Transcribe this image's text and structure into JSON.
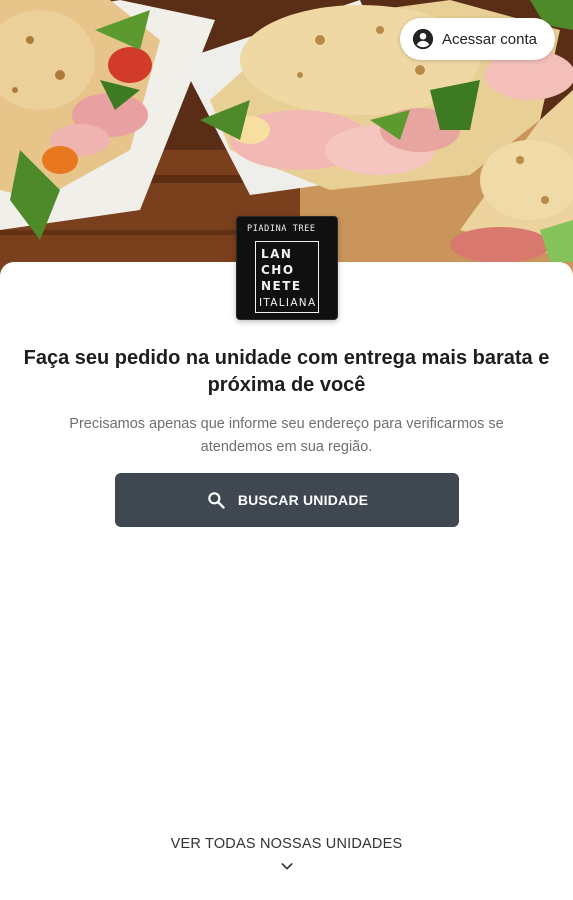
{
  "header": {
    "account_label": "Acessar conta",
    "account_icon": "account-circle-icon"
  },
  "logo": {
    "brand": "PIADINA TREE",
    "line1": "LAN",
    "line2": "CHO",
    "line3": "NETE",
    "line4": "ITALIANA"
  },
  "main": {
    "headline": "Faça seu pedido na unidade com entrega mais barata e próxima de você",
    "subtext": "Precisamos apenas que informe seu endereço para verificarmos se atendemos em sua região.",
    "search_button_label": "BUSCAR UNIDADE",
    "search_icon": "search-icon"
  },
  "footer": {
    "all_units_label": "VER TODAS NOSSAS UNIDADES",
    "chevron_icon": "chevron-down-icon"
  },
  "colors": {
    "primary_button": "#3f4750",
    "text_dark": "#1e1e1e",
    "text_muted": "#6f6f6f"
  }
}
